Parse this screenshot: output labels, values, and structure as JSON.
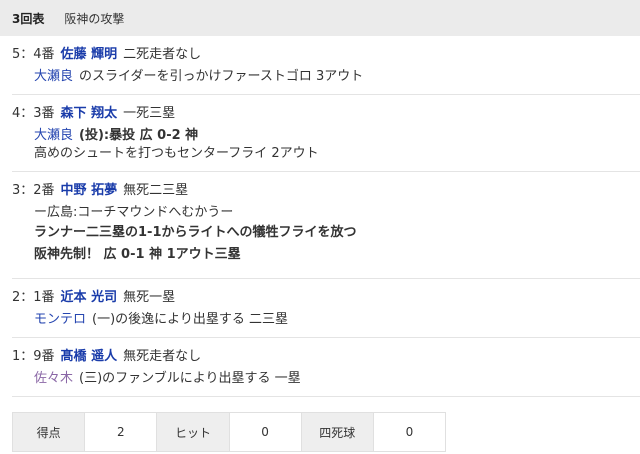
{
  "header": {
    "inning": "3回表",
    "title": "阪神の攻撃"
  },
  "entries": [
    {
      "num": "5：4番",
      "batter": "佐藤 輝明",
      "situation": "二死走者なし",
      "lines": [
        {
          "player": "大瀬良",
          "text": "のスライダーを引っかけファーストゴロ 3アウト"
        }
      ]
    },
    {
      "num": "4：3番",
      "batter": "森下 翔太",
      "situation": "一死三塁",
      "lines": [
        {
          "player": "大瀬良",
          "text": "(投):暴投 広 0-2 神"
        },
        {
          "text": "高めのシュートを打つもセンターフライ 2アウト"
        }
      ]
    },
    {
      "num": "3：2番",
      "batter": "中野 拓夢",
      "situation": "無死二三塁",
      "lines": [
        {
          "text": "ー広島:コーチマウンドへむかうー"
        },
        {
          "text": "ランナー二三塁の1-1からライトへの犠牲フライを放つ"
        },
        {
          "text": "阪神先制！ 広 0-1 神 1アウト三塁"
        }
      ]
    },
    {
      "num": "2：1番",
      "batter": "近本 光司",
      "situation": "無死一塁",
      "lines": [
        {
          "player": "モンテロ",
          "text": "(一)の後逸により出塁する 二三塁"
        }
      ]
    },
    {
      "num": "1：9番",
      "batter": "髙橋 遥人",
      "situation": "無死走者なし",
      "lines": [
        {
          "player": "佐々木",
          "text": "(三)のファンブルにより出塁する 一塁"
        }
      ]
    }
  ],
  "stats": {
    "runs_label": "得点",
    "runs": "2",
    "hits_label": "ヒット",
    "hits": "0",
    "bb_label": "四死球",
    "bb": "0"
  }
}
